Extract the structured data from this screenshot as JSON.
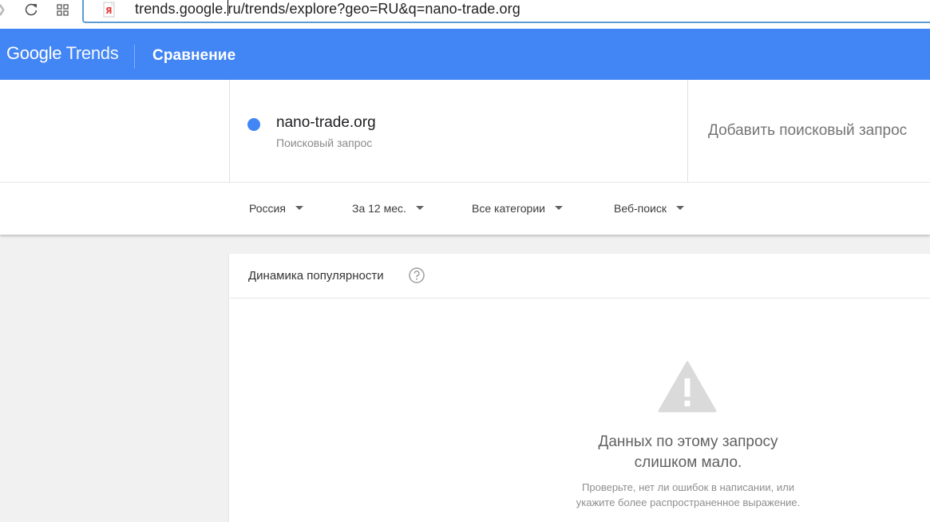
{
  "browser": {
    "url_host": "trends.google",
    "url_rest": "ru/trends/explore?geo=RU&q=nano-trade.org",
    "reload_icon": "reload-icon",
    "tabs_icon": "tabs-grid-icon",
    "site_icon": "yandex-icon"
  },
  "header": {
    "logo_google": "Google",
    "logo_trends": "Trends",
    "page_title": "Сравнение",
    "bg_color": "#4285f4"
  },
  "terms": {
    "items": [
      {
        "name": "nano-trade.org",
        "type": "Поисковый запрос",
        "color": "#4285f4"
      }
    ],
    "add_placeholder": "Добавить поисковый запрос"
  },
  "filters": {
    "region": "Россия",
    "period": "За 12 мес.",
    "category": "Все категории",
    "search_type": "Веб-поиск"
  },
  "interest": {
    "title": "Динамика популярности",
    "help_icon": "help-circle-icon",
    "warning_icon": "warning-icon",
    "empty_title_line1": "Данных по этому запросу",
    "empty_title_line2": "слишком мало.",
    "empty_sub_line1": "Проверьте, нет ли ошибок в написании, или",
    "empty_sub_line2": "укажите более распространенное выражение."
  }
}
